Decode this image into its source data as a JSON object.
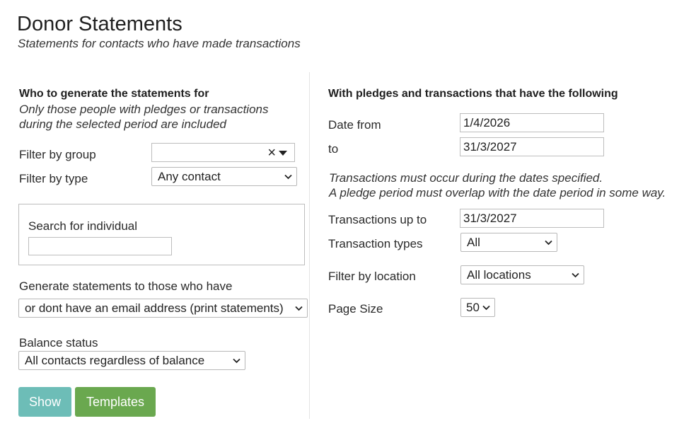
{
  "header": {
    "title": "Donor Statements",
    "subtitle": "Statements for contacts who have made transactions"
  },
  "left": {
    "heading": "Who to generate the statements for",
    "note_line1": "Only those people with pledges or transactions",
    "note_line2": "during the selected period are included",
    "filter_group_label": "Filter by group",
    "filter_group_value": "",
    "filter_type_label": "Filter by type",
    "filter_type_value": "Any contact",
    "search_label": "Search for individual",
    "search_value": "",
    "generate_label": "Generate statements to those who have",
    "generate_value": "or dont have an email address (print statements)",
    "balance_label": "Balance status",
    "balance_value": "All contacts regardless of balance"
  },
  "right": {
    "heading": "With pledges and transactions that have the following",
    "date_from_label": "Date from",
    "date_from_value": "1/4/2026",
    "date_to_label": "to",
    "date_to_value": "31/3/2027",
    "note_line1": "Transactions must occur during the dates specified.",
    "note_line2": "A pledge period must overlap with the date period in some way.",
    "transactions_upto_label": "Transactions up to",
    "transactions_upto_value": "31/3/2027",
    "transaction_types_label": "Transaction types",
    "transaction_types_value": "All",
    "location_label": "Filter by location",
    "location_value": "All locations",
    "page_size_label": "Page Size",
    "page_size_value": "50"
  },
  "actions": {
    "show_label": "Show",
    "templates_label": "Templates"
  },
  "colors": {
    "show_button": "#6dbdb7",
    "templates_button": "#6aa84f"
  }
}
